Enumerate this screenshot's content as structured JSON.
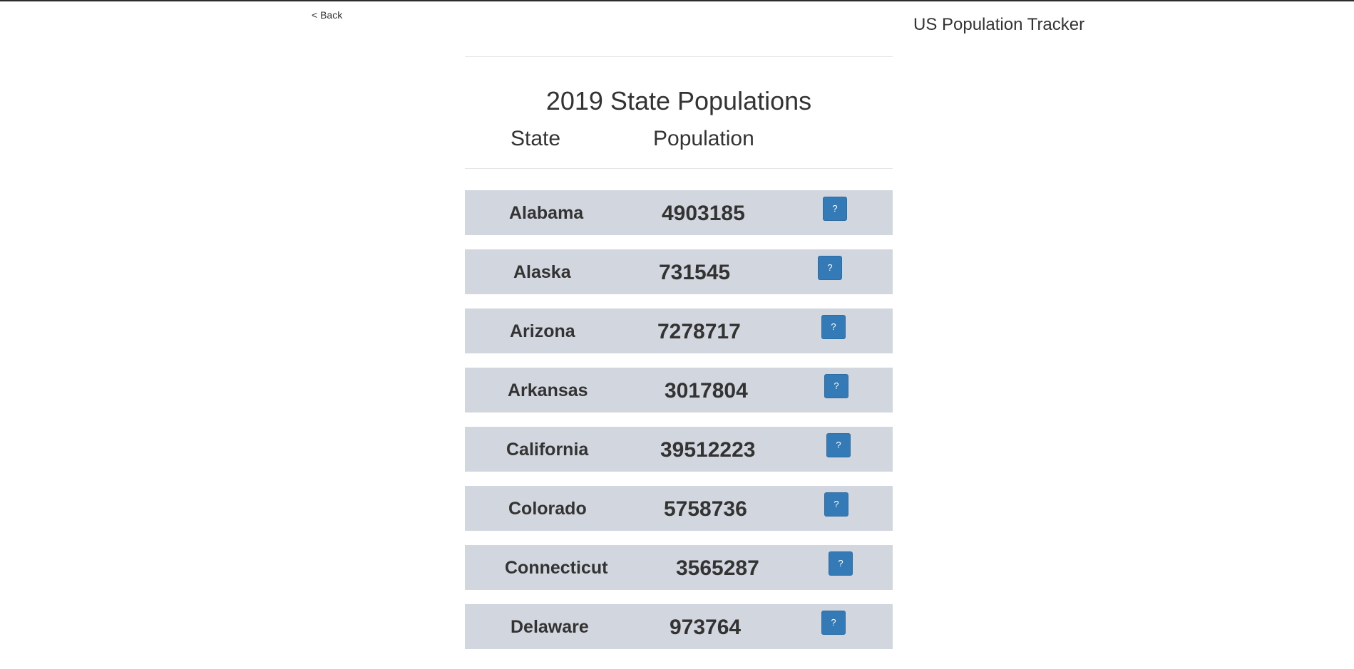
{
  "nav": {
    "back_label": "< Back"
  },
  "app": {
    "title": "US Population Tracker"
  },
  "main": {
    "title": "2019 State Populations",
    "headers": {
      "state": "State",
      "population": "Population"
    },
    "help_button_label": "?",
    "rows": [
      {
        "state": "Alabama",
        "population": "4903185"
      },
      {
        "state": "Alaska",
        "population": "731545"
      },
      {
        "state": "Arizona",
        "population": "7278717"
      },
      {
        "state": "Arkansas",
        "population": "3017804"
      },
      {
        "state": "California",
        "population": "39512223"
      },
      {
        "state": "Colorado",
        "population": "5758736"
      },
      {
        "state": "Connecticut",
        "population": "3565287"
      },
      {
        "state": "Delaware",
        "population": "973764"
      }
    ]
  },
  "colors": {
    "row_bg": "#d2d6de",
    "button": "#337ab7",
    "text": "#333333"
  }
}
